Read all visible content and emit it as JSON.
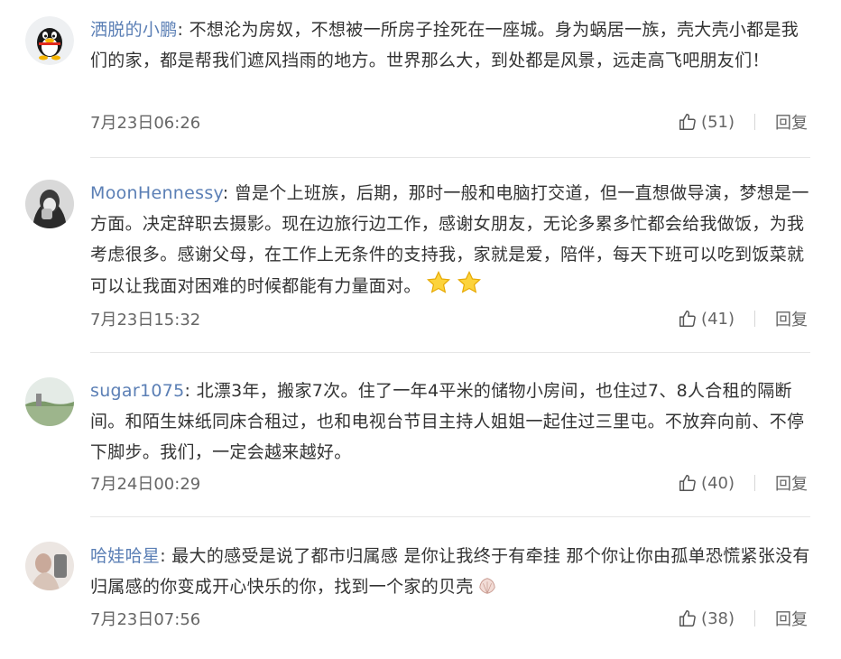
{
  "comments": [
    {
      "username": "洒脱的小鹏",
      "text": "不想沦为房奴，不想被一所房子拴死在一座城。身为蜗居一族，壳大壳小都是我们的家，都是帮我们遮风挡雨的地方。世界那么大，到处都是风景，远走高飞吧朋友们！",
      "time": "7月23日06:26",
      "likes": "(51)",
      "reply": "回复",
      "avatar_icon": "qq-penguin-icon"
    },
    {
      "username": "MoonHennessy",
      "text": "曾是个上班族，后期，那时一般和电脑打交道，但一直想做导演，梦想是一方面。决定辞职去摄影。现在边旅行边工作，感谢女朋友，无论多累多忙都会给我做饭，为我考虑很多。感谢父母，在工作上无条件的支持我，家就是爱，陪伴，每天下班可以吃到饭菜就可以让我面对困难的时候都能有力量面对。",
      "time": "7月23日15:32",
      "likes": "(41)",
      "reply": "回复",
      "avatar_icon": "photo-avatar-icon"
    },
    {
      "username": "sugar1075",
      "text": "北漂3年，搬家7次。住了一年4平米的储物小房间，也住过7、8人合租的隔断间。和陌生妹纸同床合租过，也和电视台节目主持人姐姐一起住过三里屯。不放弃向前、不停下脚步。我们，一定会越来越好。",
      "time": "7月24日00:29",
      "likes": "(40)",
      "reply": "回复",
      "avatar_icon": "landscape-avatar-icon"
    },
    {
      "username": "哈娃哈星",
      "text": "最大的感受是说了都市归属感 是你让我终于有牵挂 那个你让你由孤单恐慌紧张没有归属感的你变成开心快乐的你，找到一个家的贝壳",
      "time": "7月23日07:56",
      "likes": "(38)",
      "reply": "回复",
      "avatar_icon": "photo-avatar-icon"
    }
  ],
  "colors": {
    "username": "#5b7fb5",
    "text": "#333333",
    "meta": "#666666",
    "divider": "#e6e6e6"
  }
}
